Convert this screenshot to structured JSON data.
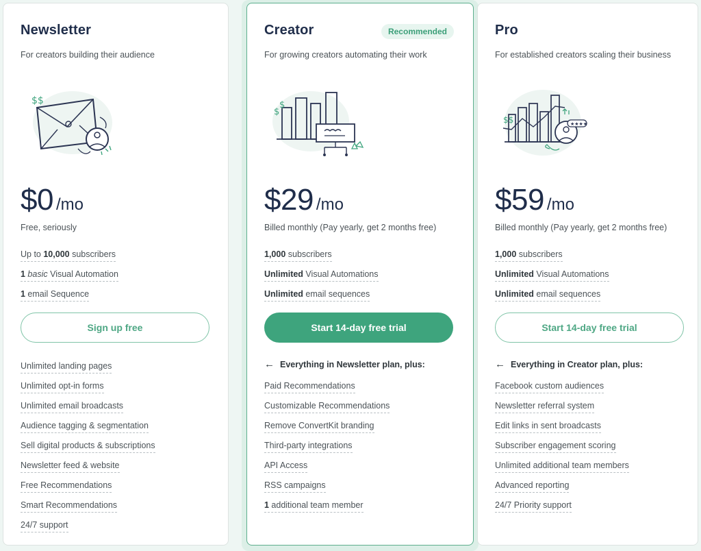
{
  "plans": [
    {
      "name": "Newsletter",
      "tagline": "For creators building their audience",
      "illustration": "envelope-with-avatar-illustration",
      "price": "$0",
      "period": "/mo",
      "price_note": "Free, seriously",
      "limits": [
        {
          "pre": "Up to ",
          "bold": "10,000",
          "italic": "",
          "post": " subscribers"
        },
        {
          "pre": "",
          "bold": "1",
          "italic": " basic",
          "post": " Visual Automation"
        },
        {
          "pre": "",
          "bold": "1",
          "italic": "",
          "post": " email Sequence"
        }
      ],
      "cta": "Sign up free",
      "cta_style": "outline",
      "includes_label": "",
      "features": [
        "Unlimited landing pages",
        "Unlimited opt-in forms",
        "Unlimited email broadcasts",
        "Audience tagging & segmentation",
        "Sell digital products & subscriptions",
        "Newsletter feed & website",
        "Free Recommendations",
        "Smart Recommendations",
        "24/7 support"
      ]
    },
    {
      "name": "Creator",
      "badge": "Recommended",
      "tagline": "For growing creators automating their work",
      "illustration": "bar-chart-automation-illustration",
      "price": "$29",
      "period": "/mo",
      "price_note": "Billed monthly (Pay yearly, get 2 months free)",
      "limits": [
        {
          "pre": "",
          "bold": "1,000",
          "italic": "",
          "post": " subscribers"
        },
        {
          "pre": "",
          "bold": "Unlimited",
          "italic": "",
          "post": " Visual Automations"
        },
        {
          "pre": "",
          "bold": "Unlimited",
          "italic": "",
          "post": " email sequences"
        }
      ],
      "cta": "Start 14-day free trial",
      "cta_style": "filled",
      "includes_label": "Everything in Newsletter plan, plus:",
      "features": [
        "Paid Recommendations",
        "Customizable Recommendations",
        "Remove ConvertKit branding",
        "Third-party integrations",
        "API Access",
        "RSS campaigns",
        {
          "bold": "1",
          "post": " additional team member"
        }
      ]
    },
    {
      "name": "Pro",
      "tagline": "For established creators scaling their business",
      "illustration": "growth-chart-rating-illustration",
      "price": "$59",
      "period": "/mo",
      "price_note": "Billed monthly (Pay yearly, get 2 months free)",
      "limits": [
        {
          "pre": "",
          "bold": "1,000",
          "italic": "",
          "post": " subscribers"
        },
        {
          "pre": "",
          "bold": "Unlimited",
          "italic": "",
          "post": " Visual Automations"
        },
        {
          "pre": "",
          "bold": "Unlimited",
          "italic": "",
          "post": " email sequences"
        }
      ],
      "cta": "Start 14-day free trial",
      "cta_style": "outline",
      "includes_label": "Everything in Creator plan, plus:",
      "features": [
        "Facebook custom audiences",
        "Newsletter referral system",
        "Edit links in sent broadcasts",
        "Subscriber engagement scoring",
        "Unlimited additional team members",
        "Advanced reporting",
        "24/7 Priority support"
      ]
    }
  ],
  "colors": {
    "accent": "#3ea47d",
    "heading": "#1f2d4a",
    "page_bg": "#eef6f3",
    "badge_bg": "#e7f5ef"
  }
}
